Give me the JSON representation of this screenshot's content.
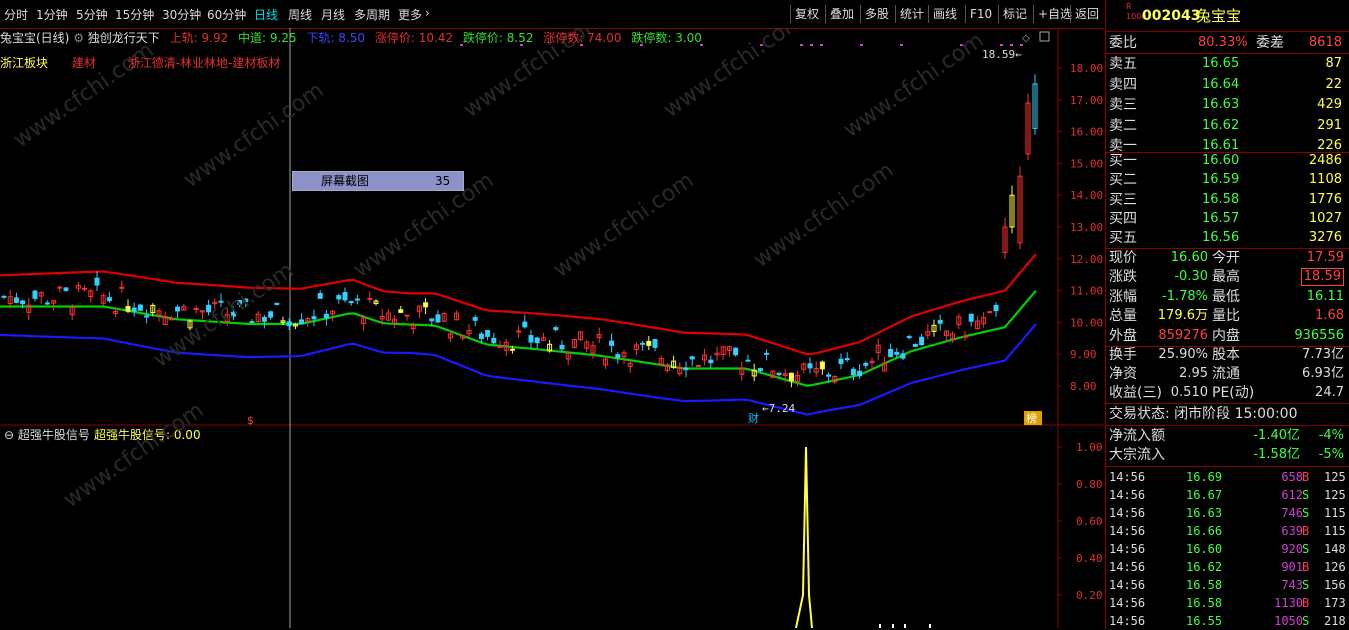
{
  "toolbar": {
    "periods": [
      "分时",
      "1分钟",
      "5分钟",
      "15分钟",
      "30分钟",
      "60分钟",
      "日线",
      "周线",
      "月线",
      "多周期",
      "更多"
    ],
    "active_period": "日线",
    "more_arrow": "›",
    "buttons": [
      "复权",
      "叠加",
      "多股",
      "统计",
      "画线",
      "F10",
      "标记",
      "+自选",
      "返回"
    ]
  },
  "indicator_line": {
    "stock": "兔宝宝(日线)",
    "indicator": "独创龙行天下",
    "upper_label": "上轨: 9.92",
    "mid_label": "中道: 9.25",
    "lower_label": "下轨: 8.50",
    "limit_up_price": "涨停价: 10.42",
    "limit_down_price": "跌停价: 8.52",
    "limit_up_count": "涨停数: 74.00",
    "limit_down_count": "跌停数: 3.00"
  },
  "sectors": [
    "浙江板块",
    "建材",
    "浙江德清-林业林地-建材板材"
  ],
  "chart_data": {
    "type": "candlestick",
    "price_axis": [
      "18.00",
      "17.00",
      "16.00",
      "15.00",
      "14.00",
      "13.00",
      "12.00",
      "11.00",
      "10.00",
      "9.00",
      "8.00"
    ],
    "high_label": "18.59",
    "low_label": "7.24",
    "bands": [
      "upper",
      "middle",
      "lower"
    ],
    "band_colors": {
      "upper": "#e00000",
      "middle": "#00d000",
      "lower": "#1a1aff"
    },
    "markers": {
      "s_marker": "$",
      "cai_marker": "财",
      "bang_marker": "榜"
    },
    "sub_indicator": {
      "title": "超强牛股信号",
      "value_label": "超强牛股信号: 0.00",
      "axis": [
        "1.00",
        "0.80",
        "0.60",
        "0.40",
        "0.20"
      ],
      "signal_peak": 1.0
    }
  },
  "context_menu": {
    "label": "屏幕截图",
    "value": "35"
  },
  "watermark": "www.cfchi.com",
  "quote": {
    "code": "002043",
    "name": "兔宝宝",
    "tag": "R 1000",
    "weibi_label": "委比",
    "weibi": "80.33%",
    "weicha_label": "委差",
    "weicha": "8618",
    "asks": [
      {
        "label": "卖五",
        "price": "16.65",
        "vol": "87"
      },
      {
        "label": "卖四",
        "price": "16.64",
        "vol": "22"
      },
      {
        "label": "卖三",
        "price": "16.63",
        "vol": "429"
      },
      {
        "label": "卖二",
        "price": "16.62",
        "vol": "291"
      },
      {
        "label": "卖一",
        "price": "16.61",
        "vol": "226"
      }
    ],
    "bids": [
      {
        "label": "买一",
        "price": "16.60",
        "vol": "2486"
      },
      {
        "label": "买二",
        "price": "16.59",
        "vol": "1108"
      },
      {
        "label": "买三",
        "price": "16.58",
        "vol": "1776"
      },
      {
        "label": "买四",
        "price": "16.57",
        "vol": "1027"
      },
      {
        "label": "买五",
        "price": "16.56",
        "vol": "3276"
      }
    ],
    "stats": [
      {
        "l1": "现价",
        "v1": "16.60",
        "l2": "今开",
        "v2": "17.59"
      },
      {
        "l1": "涨跌",
        "v1": "-0.30",
        "l2": "最高",
        "v2": "18.59"
      },
      {
        "l1": "涨幅",
        "v1": "-1.78%",
        "l2": "最低",
        "v2": "16.11"
      },
      {
        "l1": "总量",
        "v1": "179.6万",
        "l2": "量比",
        "v2": "1.68"
      },
      {
        "l1": "外盘",
        "v1": "859276",
        "l2": "内盘",
        "v2": "936556"
      }
    ],
    "stats2": [
      {
        "l1": "换手",
        "v1": "25.90%",
        "l2": "股本",
        "v2": "7.73亿"
      },
      {
        "l1": "净资",
        "v1": "2.95",
        "l2": "流通",
        "v2": "6.93亿"
      },
      {
        "l1": "收益(三)",
        "v1": "0.510",
        "l2": "PE(动)",
        "v2": "24.7"
      }
    ],
    "trade_status": "交易状态: 闭市阶段 15:00:00",
    "flows": [
      {
        "label": "净流入额",
        "value": "-1.40亿",
        "pct": "-4%"
      },
      {
        "label": "大宗流入",
        "value": "-1.58亿",
        "pct": "-5%"
      }
    ],
    "ticks": [
      {
        "time": "14:56",
        "price": "16.69",
        "vol": "658",
        "side": "B",
        "num": "125"
      },
      {
        "time": "14:56",
        "price": "16.67",
        "vol": "612",
        "side": "S",
        "num": "125"
      },
      {
        "time": "14:56",
        "price": "16.63",
        "vol": "746",
        "side": "S",
        "num": "115"
      },
      {
        "time": "14:56",
        "price": "16.66",
        "vol": "639",
        "side": "B",
        "num": "115"
      },
      {
        "time": "14:56",
        "price": "16.60",
        "vol": "920",
        "side": "S",
        "num": "148"
      },
      {
        "time": "14:56",
        "price": "16.62",
        "vol": "901",
        "side": "B",
        "num": "126"
      },
      {
        "time": "14:56",
        "price": "16.58",
        "vol": "743",
        "side": "S",
        "num": "156"
      },
      {
        "time": "14:56",
        "price": "16.58",
        "vol": "1130",
        "side": "B",
        "num": "173"
      },
      {
        "time": "14:56",
        "price": "16.55",
        "vol": "1050",
        "side": "S",
        "num": "218"
      }
    ]
  }
}
